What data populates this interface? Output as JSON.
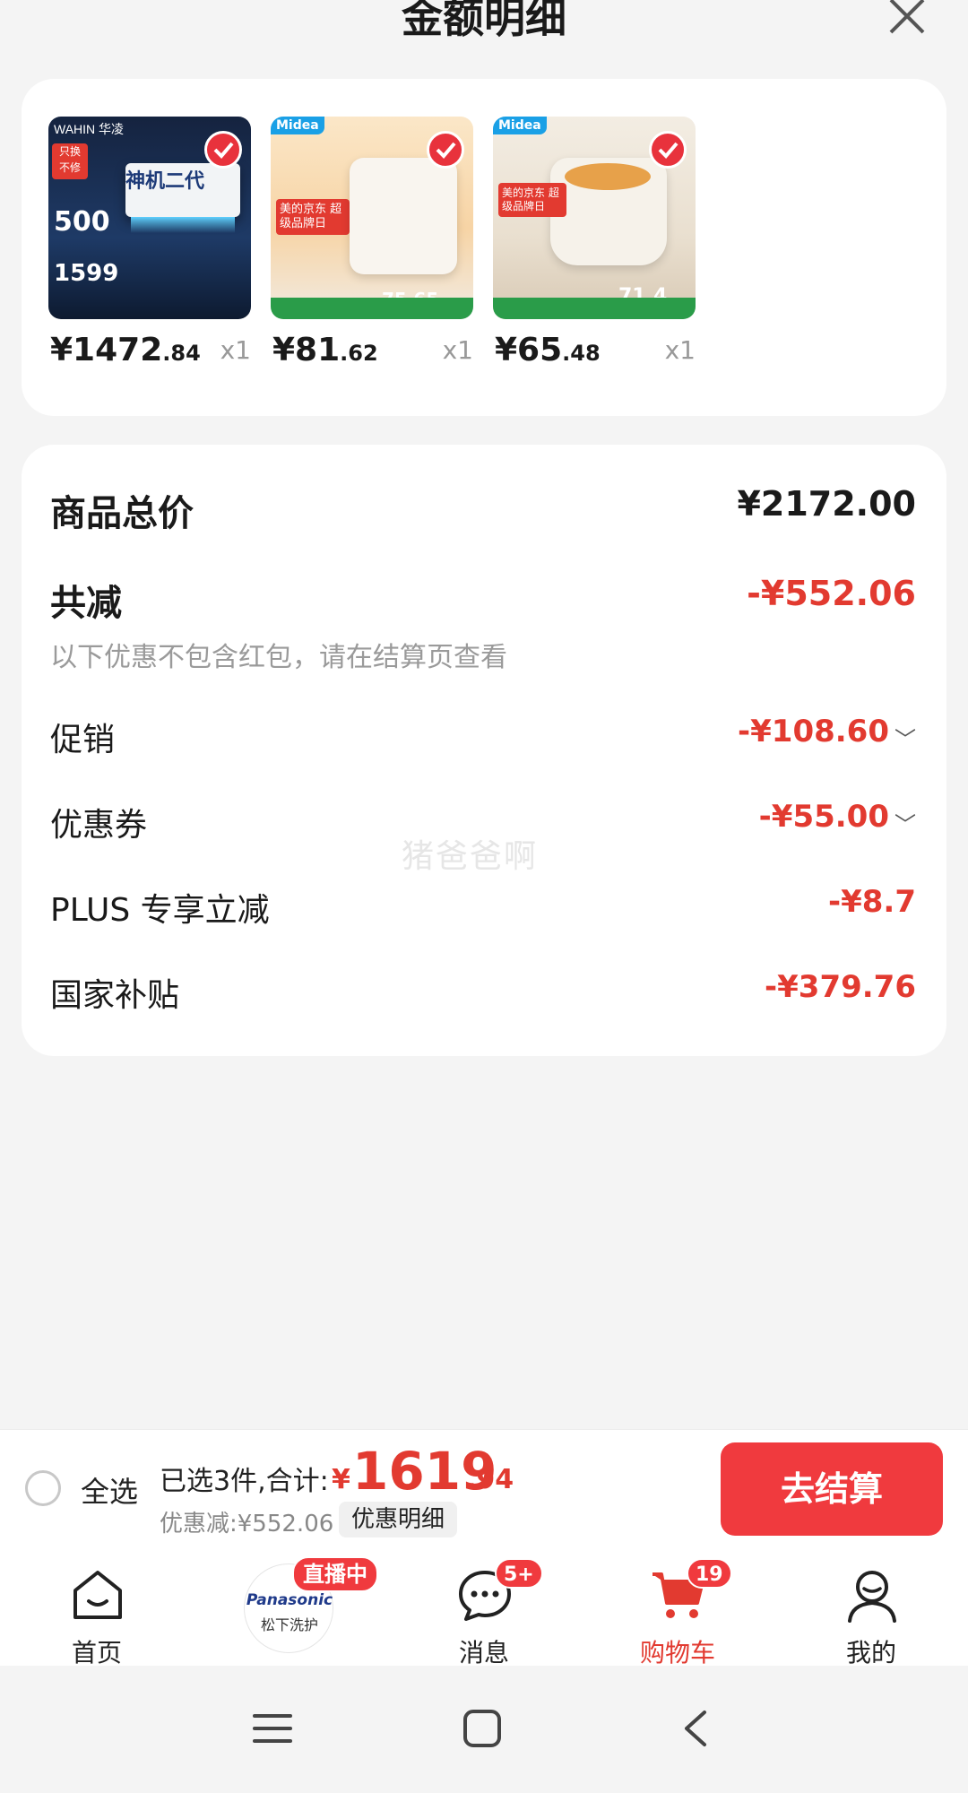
{
  "header": {
    "title": "金额明细"
  },
  "products": [
    {
      "price_int": "¥1472",
      "price_dec": ".84",
      "qty": "x1",
      "thumb_text": "神机二代",
      "promo": "1599",
      "brand": "WAHIN 华凌",
      "badge": "500"
    },
    {
      "price_int": "¥81",
      "price_dec": ".62",
      "qty": "x1",
      "thumb_text": "美的京东 超级品牌日",
      "promo": "75.65",
      "brand": "Midea"
    },
    {
      "price_int": "¥65",
      "price_dec": ".48",
      "qty": "x1",
      "thumb_text": "美的京东 超级品牌日",
      "promo": "71.4",
      "brand": "Midea"
    }
  ],
  "summary": {
    "total_label": "商品总价",
    "total_value": "¥2172.00",
    "reduce_label": "共减",
    "reduce_value": "-¥552.06",
    "note": "以下优惠不包含红包，请在结算页查看",
    "items": [
      {
        "label": "促销",
        "value": "-¥108.60",
        "expandable": true
      },
      {
        "label": "优惠券",
        "value": "-¥55.00",
        "expandable": true
      },
      {
        "label": "PLUS 专享立减",
        "value": "-¥8.7",
        "expandable": false
      },
      {
        "label": "国家补贴",
        "value": "-¥379.76",
        "expandable": false
      }
    ],
    "watermark": "猪爸爸啊"
  },
  "checkout": {
    "select_all": "全选",
    "selected_text": "已选3件,合计:",
    "yen": "¥",
    "total_int": "1619",
    "total_dec": ".94",
    "discount_text": "优惠减:¥552.06",
    "detail_button": "优惠明细",
    "checkout_button": "去结算"
  },
  "tabbar": {
    "home": "首页",
    "live_badge": "直播中",
    "live_brand_logo": "Panasonic",
    "live_brand_name": "松下洗护",
    "messages": "消息",
    "messages_badge": "5+",
    "cart": "购物车",
    "cart_badge": "19",
    "me": "我的"
  },
  "colors": {
    "accent": "#e23a30",
    "button": "#f03a3e"
  }
}
